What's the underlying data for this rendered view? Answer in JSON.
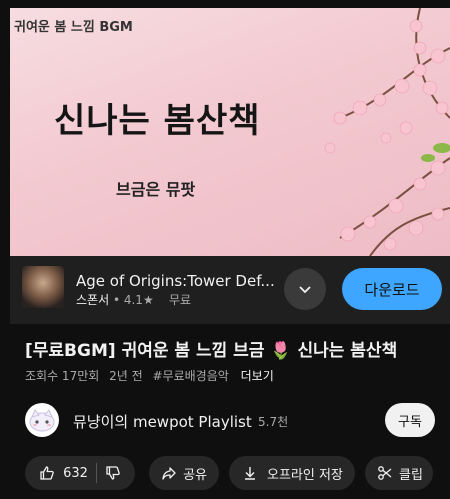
{
  "video": {
    "corner_title": "귀여운 봄 느낌 BGM",
    "main_title": "신나는 봄산책",
    "sub_title": "브금은 뮤팟"
  },
  "ad": {
    "name": "Age of Origins:Tower Def...",
    "sponsor": "스폰서",
    "rating": "4.1★",
    "price": "무료",
    "download_label": "다운로드"
  },
  "title": "[무료BGM] 귀여운 봄 느낌 브금 🌷 신나는 봄산책",
  "stats": {
    "views": "조회수 17만회",
    "age": "2년 전",
    "tag": "#무료배경음악",
    "more": "더보기"
  },
  "channel": {
    "name": "뮤냥이의 mewpot Playlist",
    "subscribers": "5.7천",
    "subscribe_label": "구독"
  },
  "actions": {
    "likes": "632",
    "share": "공유",
    "offline": "오프라인 저장",
    "clip": "클립"
  },
  "colors": {
    "accent": "#3ea6ff",
    "background": "#0f0f0f",
    "pill": "#272727"
  },
  "icons": [
    "chevron-down-icon",
    "thumbs-up-icon",
    "thumbs-down-icon",
    "share-icon",
    "download-icon",
    "scissors-icon"
  ]
}
